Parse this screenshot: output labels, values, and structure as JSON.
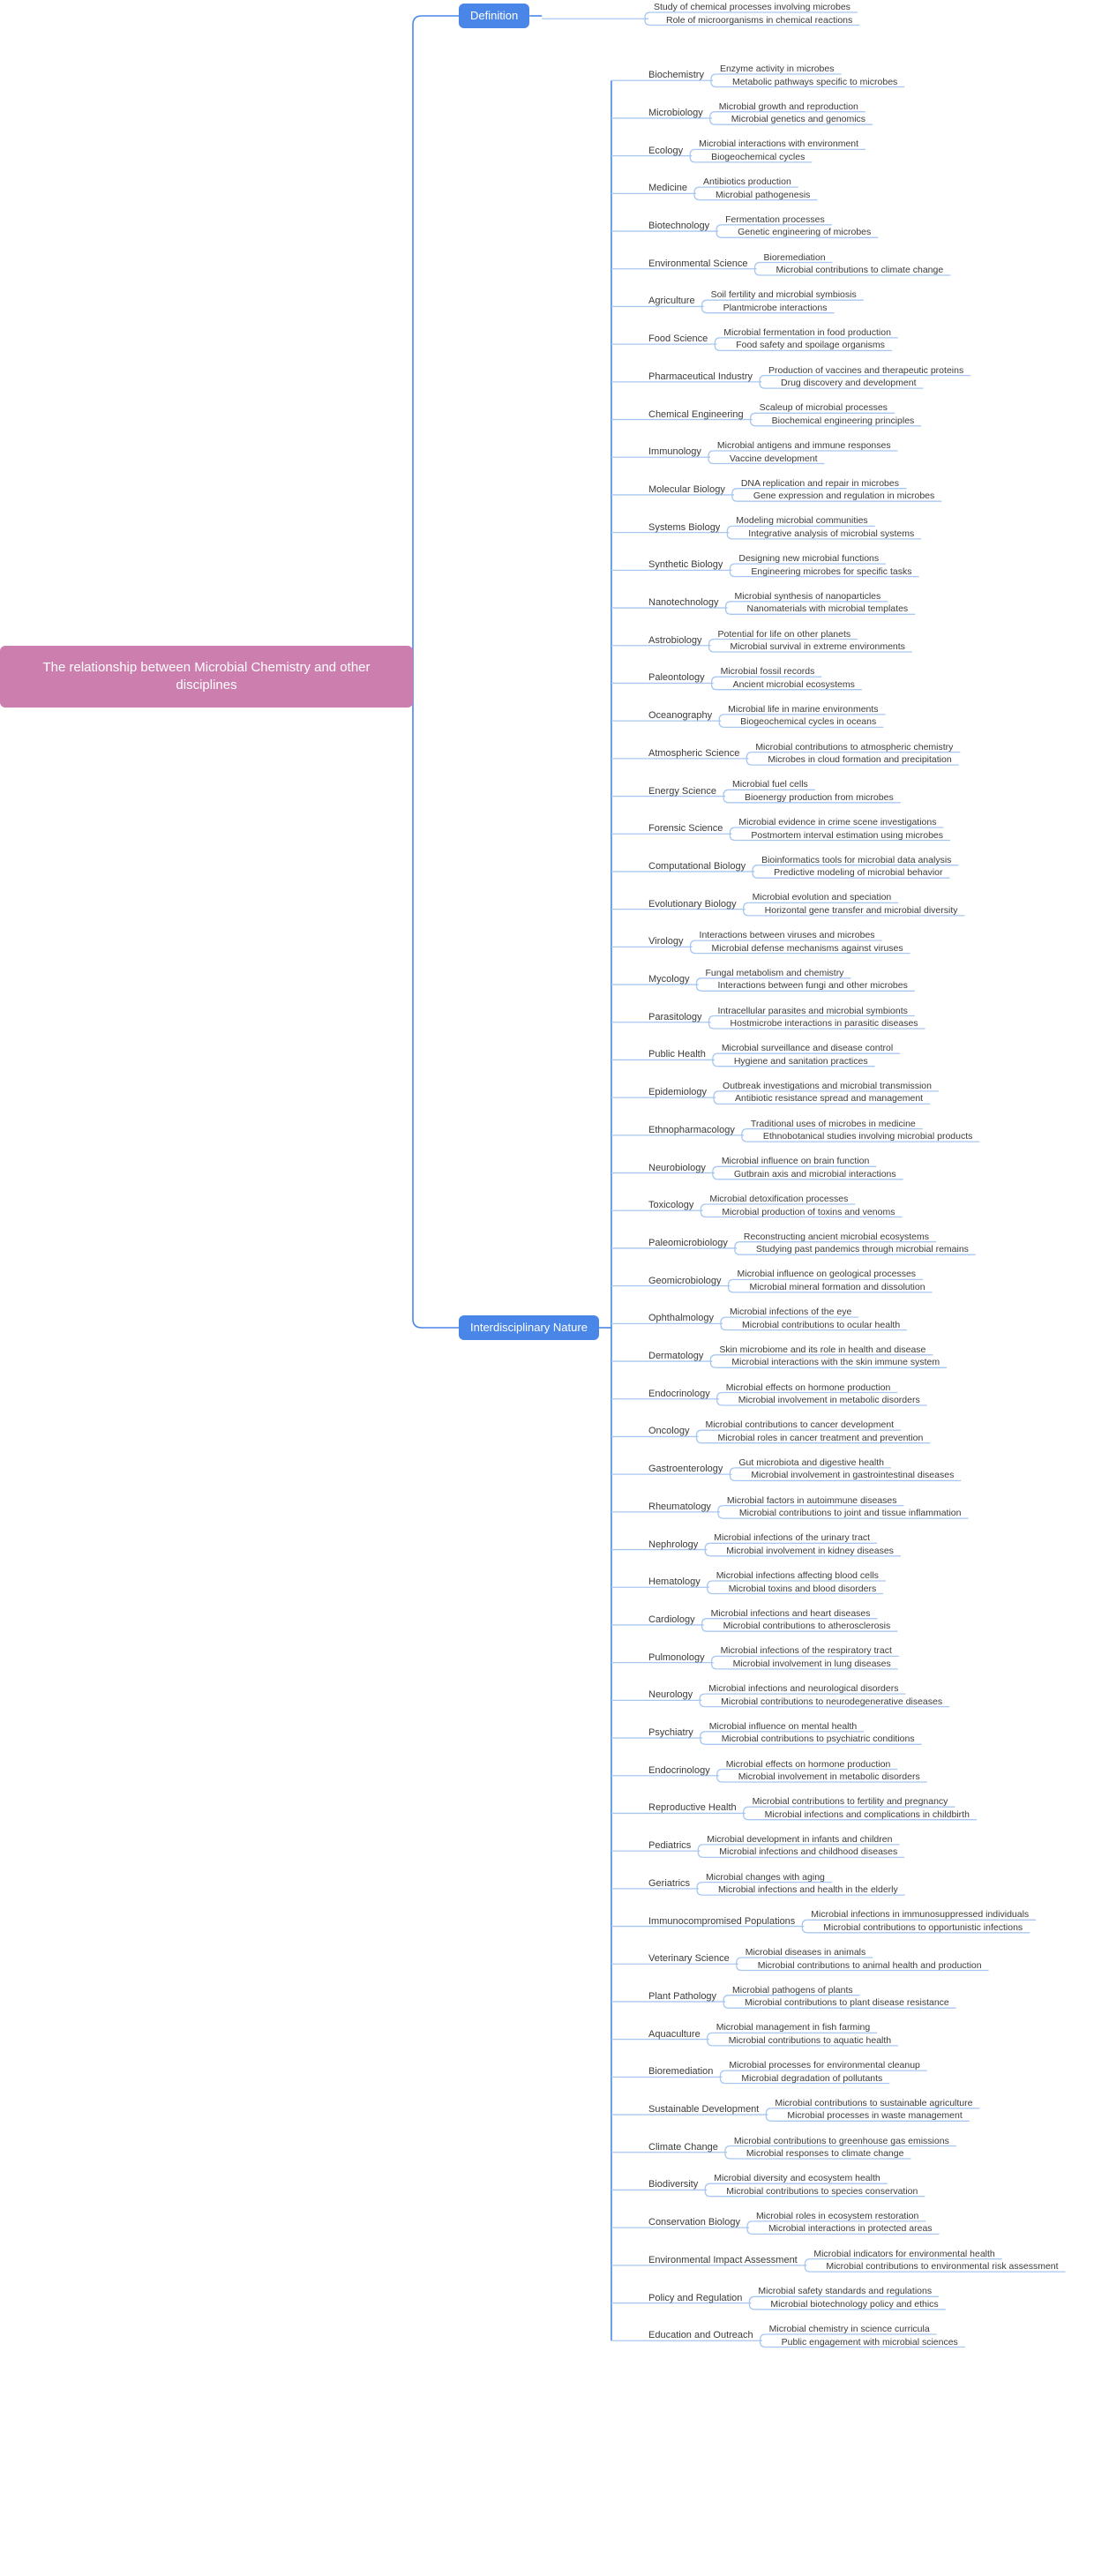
{
  "colors": {
    "root_fill": "#cc7faf",
    "branch_fill": "#4a86e8",
    "wire_primary": "#4a86e8",
    "wire_secondary": "#a8c7f0",
    "text_dark": "#3b3b3b",
    "text_light": "#ffffff",
    "background": "#ffffff"
  },
  "root": {
    "label": "The relationship between Microbial Chemistry and other disciplines"
  },
  "branches": [
    {
      "label": "Definition",
      "topics": [
        {
          "label": "",
          "leaves": [
            "Study of chemical processes involving microbes",
            "Role of microorganisms in chemical reactions"
          ]
        }
      ]
    },
    {
      "label": "Interdisciplinary Nature",
      "topics": [
        {
          "label": "Biochemistry",
          "leaves": [
            "Enzyme activity in microbes",
            "Metabolic pathways specific to microbes"
          ]
        },
        {
          "label": "Microbiology",
          "leaves": [
            "Microbial growth and reproduction",
            "Microbial genetics and genomics"
          ]
        },
        {
          "label": "Ecology",
          "leaves": [
            "Microbial interactions with environment",
            "Biogeochemical cycles"
          ]
        },
        {
          "label": "Medicine",
          "leaves": [
            "Antibiotics production",
            "Microbial pathogenesis"
          ]
        },
        {
          "label": "Biotechnology",
          "leaves": [
            "Fermentation processes",
            "Genetic engineering of microbes"
          ]
        },
        {
          "label": "Environmental Science",
          "leaves": [
            "Bioremediation",
            "Microbial contributions to climate change"
          ]
        },
        {
          "label": "Agriculture",
          "leaves": [
            "Soil fertility and microbial symbiosis",
            "Plantmicrobe interactions"
          ]
        },
        {
          "label": "Food Science",
          "leaves": [
            "Microbial fermentation in food production",
            "Food safety and spoilage organisms"
          ]
        },
        {
          "label": "Pharmaceutical Industry",
          "leaves": [
            "Production of vaccines and therapeutic proteins",
            "Drug discovery and development"
          ]
        },
        {
          "label": "Chemical Engineering",
          "leaves": [
            "Scaleup of microbial processes",
            "Biochemical engineering principles"
          ]
        },
        {
          "label": "Immunology",
          "leaves": [
            "Microbial antigens and immune responses",
            "Vaccine development"
          ]
        },
        {
          "label": "Molecular Biology",
          "leaves": [
            "DNA replication and repair in microbes",
            "Gene expression and regulation in microbes"
          ]
        },
        {
          "label": "Systems Biology",
          "leaves": [
            "Modeling microbial communities",
            "Integrative analysis of microbial systems"
          ]
        },
        {
          "label": "Synthetic Biology",
          "leaves": [
            "Designing new microbial functions",
            "Engineering microbes for specific tasks"
          ]
        },
        {
          "label": "Nanotechnology",
          "leaves": [
            "Microbial synthesis of nanoparticles",
            "Nanomaterials with microbial templates"
          ]
        },
        {
          "label": "Astrobiology",
          "leaves": [
            "Potential for life on other planets",
            "Microbial survival in extreme environments"
          ]
        },
        {
          "label": "Paleontology",
          "leaves": [
            "Microbial fossil records",
            "Ancient microbial ecosystems"
          ]
        },
        {
          "label": "Oceanography",
          "leaves": [
            "Microbial life in marine environments",
            "Biogeochemical cycles in oceans"
          ]
        },
        {
          "label": "Atmospheric Science",
          "leaves": [
            "Microbial contributions to atmospheric chemistry",
            "Microbes in cloud formation and precipitation"
          ]
        },
        {
          "label": "Energy Science",
          "leaves": [
            "Microbial fuel cells",
            "Bioenergy production from microbes"
          ]
        },
        {
          "label": "Forensic Science",
          "leaves": [
            "Microbial evidence in crime scene investigations",
            "Postmortem interval estimation using microbes"
          ]
        },
        {
          "label": "Computational Biology",
          "leaves": [
            "Bioinformatics tools for microbial data analysis",
            "Predictive modeling of microbial behavior"
          ]
        },
        {
          "label": "Evolutionary Biology",
          "leaves": [
            "Microbial evolution and speciation",
            "Horizontal gene transfer and microbial diversity"
          ]
        },
        {
          "label": "Virology",
          "leaves": [
            "Interactions between viruses and microbes",
            "Microbial defense mechanisms against viruses"
          ]
        },
        {
          "label": "Mycology",
          "leaves": [
            "Fungal metabolism and chemistry",
            "Interactions between fungi and other microbes"
          ]
        },
        {
          "label": "Parasitology",
          "leaves": [
            "Intracellular parasites and microbial symbionts",
            "Hostmicrobe interactions in parasitic diseases"
          ]
        },
        {
          "label": "Public Health",
          "leaves": [
            "Microbial surveillance and disease control",
            "Hygiene and sanitation practices"
          ]
        },
        {
          "label": "Epidemiology",
          "leaves": [
            "Outbreak investigations and microbial transmission",
            "Antibiotic resistance spread and management"
          ]
        },
        {
          "label": "Ethnopharmacology",
          "leaves": [
            "Traditional uses of microbes in medicine",
            "Ethnobotanical studies involving microbial products"
          ]
        },
        {
          "label": "Neurobiology",
          "leaves": [
            "Microbial influence on brain function",
            "Gutbrain axis and microbial interactions"
          ]
        },
        {
          "label": "Toxicology",
          "leaves": [
            "Microbial detoxification processes",
            "Microbial production of toxins and venoms"
          ]
        },
        {
          "label": "Paleomicrobiology",
          "leaves": [
            "Reconstructing ancient microbial ecosystems",
            "Studying past pandemics through microbial remains"
          ]
        },
        {
          "label": "Geomicrobiology",
          "leaves": [
            "Microbial influence on geological processes",
            "Microbial mineral formation and dissolution"
          ]
        },
        {
          "label": "Ophthalmology",
          "leaves": [
            "Microbial infections of the eye",
            "Microbial contributions to ocular health"
          ]
        },
        {
          "label": "Dermatology",
          "leaves": [
            "Skin microbiome and its role in health and disease",
            "Microbial interactions with the skin immune system"
          ]
        },
        {
          "label": "Endocrinology",
          "leaves": [
            "Microbial effects on hormone production",
            "Microbial involvement in metabolic disorders"
          ]
        },
        {
          "label": "Oncology",
          "leaves": [
            "Microbial contributions to cancer development",
            "Microbial roles in cancer treatment and prevention"
          ]
        },
        {
          "label": "Gastroenterology",
          "leaves": [
            "Gut microbiota and digestive health",
            "Microbial involvement in gastrointestinal diseases"
          ]
        },
        {
          "label": "Rheumatology",
          "leaves": [
            "Microbial factors in autoimmune diseases",
            "Microbial contributions to joint and tissue inflammation"
          ]
        },
        {
          "label": "Nephrology",
          "leaves": [
            "Microbial infections of the urinary tract",
            "Microbial involvement in kidney diseases"
          ]
        },
        {
          "label": "Hematology",
          "leaves": [
            "Microbial infections affecting blood cells",
            "Microbial toxins and blood disorders"
          ]
        },
        {
          "label": "Cardiology",
          "leaves": [
            "Microbial infections and heart diseases",
            "Microbial contributions to atherosclerosis"
          ]
        },
        {
          "label": "Pulmonology",
          "leaves": [
            "Microbial infections of the respiratory tract",
            "Microbial involvement in lung diseases"
          ]
        },
        {
          "label": "Neurology",
          "leaves": [
            "Microbial infections and neurological disorders",
            "Microbial contributions to neurodegenerative diseases"
          ]
        },
        {
          "label": "Psychiatry",
          "leaves": [
            "Microbial influence on mental health",
            "Microbial contributions to psychiatric conditions"
          ]
        },
        {
          "label": "Endocrinology",
          "leaves": [
            "Microbial effects on hormone production",
            "Microbial involvement in metabolic disorders"
          ]
        },
        {
          "label": "Reproductive Health",
          "leaves": [
            "Microbial contributions to fertility and pregnancy",
            "Microbial infections and complications in childbirth"
          ]
        },
        {
          "label": "Pediatrics",
          "leaves": [
            "Microbial development in infants and children",
            "Microbial infections and childhood diseases"
          ]
        },
        {
          "label": "Geriatrics",
          "leaves": [
            "Microbial changes with aging",
            "Microbial infections and health in the elderly"
          ]
        },
        {
          "label": "Immunocompromised Populations",
          "leaves": [
            "Microbial infections in immunosuppressed individuals",
            "Microbial contributions to opportunistic infections"
          ]
        },
        {
          "label": "Veterinary Science",
          "leaves": [
            "Microbial diseases in animals",
            "Microbial contributions to animal health and production"
          ]
        },
        {
          "label": "Plant Pathology",
          "leaves": [
            "Microbial pathogens of plants",
            "Microbial contributions to plant disease resistance"
          ]
        },
        {
          "label": "Aquaculture",
          "leaves": [
            "Microbial management in fish farming",
            "Microbial contributions to aquatic health"
          ]
        },
        {
          "label": "Bioremediation",
          "leaves": [
            "Microbial processes for environmental cleanup",
            "Microbial degradation of pollutants"
          ]
        },
        {
          "label": "Sustainable Development",
          "leaves": [
            "Microbial contributions to sustainable agriculture",
            "Microbial processes in waste management"
          ]
        },
        {
          "label": "Climate Change",
          "leaves": [
            "Microbial contributions to greenhouse gas emissions",
            "Microbial responses to climate change"
          ]
        },
        {
          "label": "Biodiversity",
          "leaves": [
            "Microbial diversity and ecosystem health",
            "Microbial contributions to species conservation"
          ]
        },
        {
          "label": "Conservation Biology",
          "leaves": [
            "Microbial roles in ecosystem restoration",
            "Microbial interactions in protected areas"
          ]
        },
        {
          "label": "Environmental Impact Assessment",
          "leaves": [
            "Microbial indicators for environmental health",
            "Microbial contributions to environmental risk assessment"
          ]
        },
        {
          "label": "Policy and Regulation",
          "leaves": [
            "Microbial safety standards and regulations",
            "Microbial biotechnology policy and ethics"
          ]
        },
        {
          "label": "Education and Outreach",
          "leaves": [
            "Microbial chemistry in science curricula",
            "Public engagement with microbial sciences"
          ]
        }
      ]
    }
  ]
}
